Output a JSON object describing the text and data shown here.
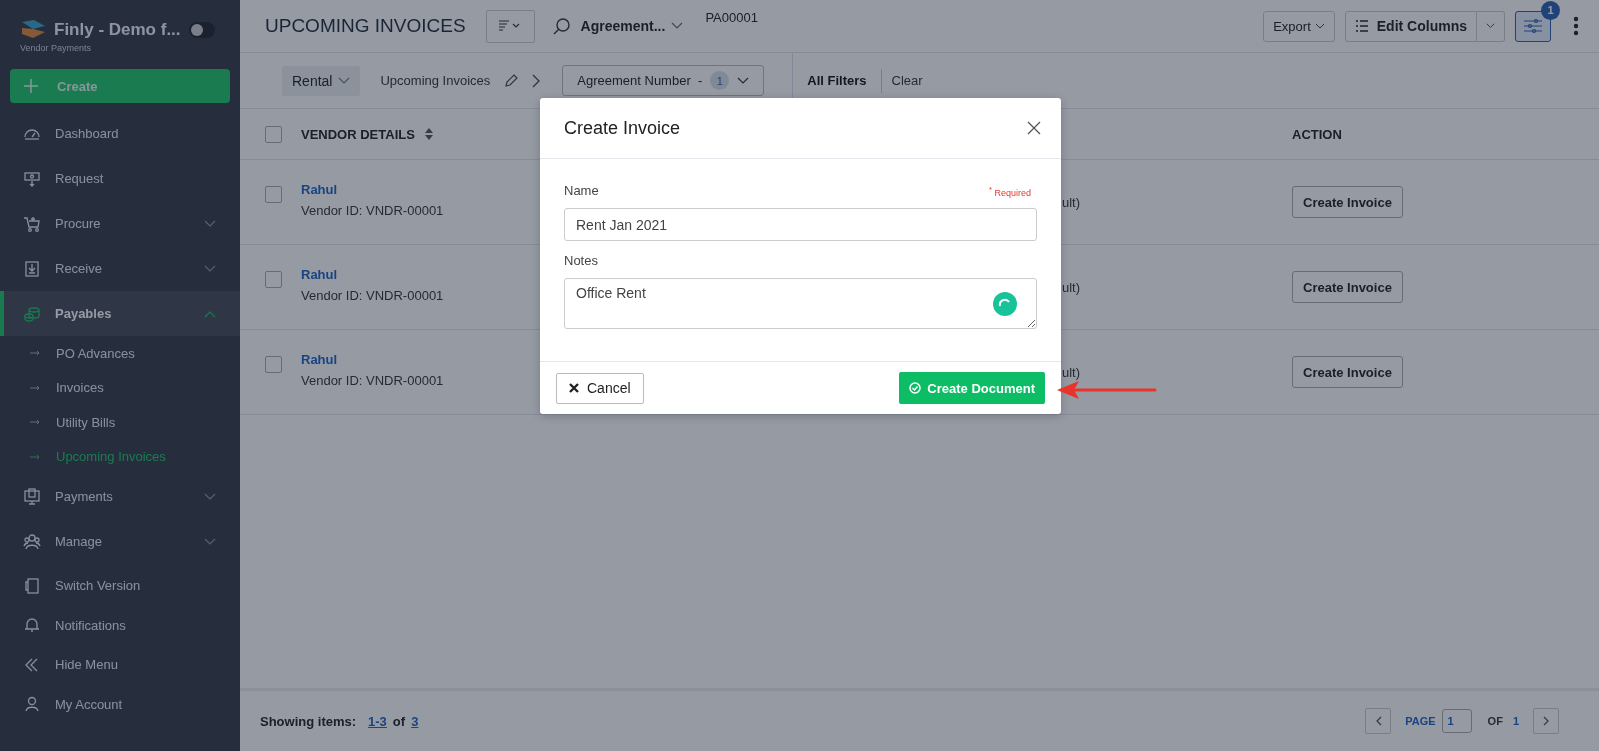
{
  "sidebar": {
    "brand": "Finly - Demo f...",
    "subtitle": "Vendor Payments",
    "toggle_on": false,
    "create": "Create",
    "items": [
      {
        "label": "Dashboard",
        "selected": false
      },
      {
        "label": "Request",
        "selected": false
      },
      {
        "label": "Procure",
        "selected": false,
        "expanded": false
      },
      {
        "label": "Receive",
        "selected": false,
        "expanded": false
      },
      {
        "label": "Payables",
        "selected": true,
        "expanded": true,
        "children": [
          {
            "label": "PO Advances",
            "selected": false
          },
          {
            "label": "Invoices",
            "selected": false
          },
          {
            "label": "Utility Bills",
            "selected": false
          },
          {
            "label": "Upcoming Invoices",
            "selected": true
          }
        ]
      },
      {
        "label": "Payments",
        "selected": false,
        "expanded": false
      },
      {
        "label": "Manage",
        "selected": false,
        "expanded": false
      }
    ],
    "bottom_items": [
      {
        "label": "Switch Version"
      },
      {
        "label": "Notifications"
      },
      {
        "label": "Hide Menu"
      },
      {
        "label": "My Account"
      }
    ]
  },
  "header": {
    "title": "UPCOMING INVOICES",
    "search_field": "Agreement...",
    "search_value": "PA00001",
    "export": "Export",
    "edit_columns": "Edit Columns",
    "filter_badge": "1"
  },
  "filter_bar": {
    "view": "Rental",
    "view_name": "Upcoming Invoices",
    "chip": "Agreement Number  -",
    "chip_count": "1",
    "all_filters": "All Filters",
    "clear": "Clear"
  },
  "table": {
    "select_all_checked": false,
    "columns": [
      {
        "label": "VENDOR DETAILS",
        "sortable": true
      },
      {
        "label": "ACTION",
        "sortable": false
      }
    ],
    "rows": [
      {
        "checked": false,
        "vendor": "Rahul",
        "vendor_id": "Vendor ID: VNDR-00001",
        "column_2": "ult)",
        "action": "Create Invoice"
      },
      {
        "checked": false,
        "vendor": "Rahul",
        "vendor_id": "Vendor ID: VNDR-00001",
        "column_2": "ult)",
        "action": "Create Invoice"
      },
      {
        "checked": false,
        "vendor": "Rahul",
        "vendor_id": "Vendor ID: VNDR-00001",
        "column_2": "ult)",
        "action": "Create Invoice"
      }
    ]
  },
  "footer": {
    "showing": "Showing items:",
    "range": "1-3",
    "of": "of",
    "total": "3",
    "page_label": "PAGE",
    "page": "1",
    "of_label": "OF",
    "pages": "1"
  },
  "modal": {
    "title": "Create Invoice",
    "name_label": "Name",
    "required": "$^{*}$ Required",
    "name_value": "Rent Jan 2021",
    "notes_label": "Notes",
    "notes_value": "Office Rent",
    "cancel": "Cancel",
    "submit": "Create Document"
  }
}
